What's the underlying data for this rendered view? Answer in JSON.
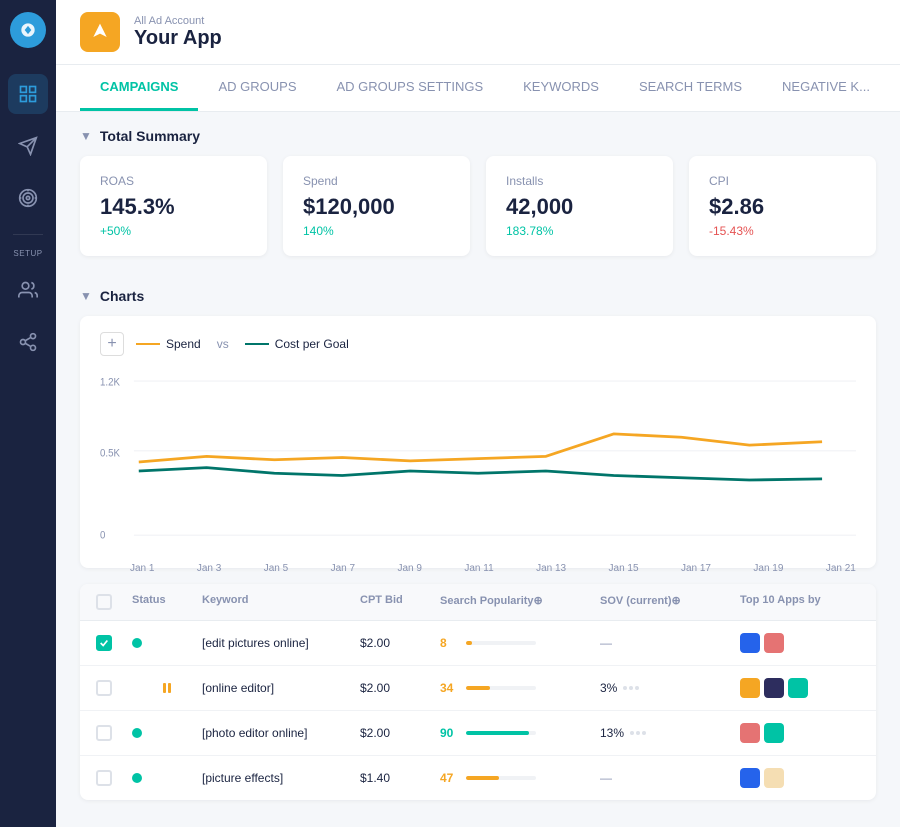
{
  "sidebar": {
    "logo_color": "#2d9cdb",
    "items": [
      {
        "id": "dashboard",
        "icon": "grid",
        "active": true
      },
      {
        "id": "campaigns",
        "icon": "send"
      },
      {
        "id": "targeting",
        "icon": "crosshair"
      },
      {
        "id": "setup",
        "label": "SETUP"
      },
      {
        "id": "users",
        "icon": "users"
      },
      {
        "id": "network",
        "icon": "share"
      }
    ]
  },
  "header": {
    "account": "All Ad Account",
    "app_name": "Your App"
  },
  "nav": {
    "tabs": [
      {
        "id": "campaigns",
        "label": "CAMPAIGNS",
        "active": true
      },
      {
        "id": "ad-groups",
        "label": "AD GROUPS"
      },
      {
        "id": "ad-groups-settings",
        "label": "AD GROUPS SETTINGS"
      },
      {
        "id": "keywords",
        "label": "KEYWORDS"
      },
      {
        "id": "search-terms",
        "label": "SEARCH TERMS"
      },
      {
        "id": "negative-k",
        "label": "NEGATIVE K..."
      }
    ]
  },
  "summary": {
    "title": "Total Summary",
    "cards": [
      {
        "label": "ROAS",
        "value": "145.3%",
        "change": "+50%",
        "change_type": "positive"
      },
      {
        "label": "Spend",
        "value": "$120,000",
        "change": "140%",
        "change_type": "positive"
      },
      {
        "label": "Installs",
        "value": "42,000",
        "change": "183.78%",
        "change_type": "positive"
      },
      {
        "label": "CPI",
        "value": "$2.86",
        "change": "-15.43%",
        "change_type": "negative"
      }
    ]
  },
  "charts": {
    "title": "Charts",
    "add_btn": "+",
    "legend": {
      "spend_label": "Spend",
      "vs_label": "vs",
      "cpg_label": "Cost per Goal"
    },
    "y_axis": [
      "1.2K",
      "0.5K",
      "0"
    ],
    "x_axis": [
      "Jan 1",
      "Jan 3",
      "Jan 5",
      "Jan 7",
      "Jan 9",
      "Jan 11",
      "Jan 13",
      "Jan 15",
      "Jan 17",
      "Jan 19",
      "Jan 21"
    ],
    "spend_color": "#f5a623",
    "cpg_color": "#00756a"
  },
  "table": {
    "columns": [
      "",
      "Status",
      "Keyword",
      "CPT Bid",
      "Search Popularity⊕",
      "SOV (current)⊕",
      "Top 10 Apps by"
    ],
    "rows": [
      {
        "checked": true,
        "status": "active",
        "keyword": "[edit pictures online]",
        "cpt_bid": "$2.00",
        "popularity_value": "8",
        "popularity_pct": 8,
        "popularity_color": "#f5a623",
        "sov": "—",
        "sov_pct": null,
        "top_apps": [
          "#2563eb",
          "#e57373"
        ]
      },
      {
        "checked": false,
        "status": "paused",
        "keyword": "[online editor]",
        "cpt_bid": "$2.00",
        "popularity_value": "34",
        "popularity_pct": 34,
        "popularity_color": "#f5a623",
        "sov": "3%",
        "sov_pct": 3,
        "top_apps": [
          "#f5a623",
          "#2d2d5e",
          "#00c3a5"
        ]
      },
      {
        "checked": false,
        "status": "active",
        "keyword": "[photo editor online]",
        "cpt_bid": "$2.00",
        "popularity_value": "90",
        "popularity_pct": 90,
        "popularity_color": "#00c3a5",
        "sov": "13%",
        "sov_pct": 13,
        "top_apps": [
          "#e57373",
          "#00c3a5"
        ]
      },
      {
        "checked": false,
        "status": "active",
        "keyword": "[picture effects]",
        "cpt_bid": "$1.40",
        "popularity_value": "47",
        "popularity_pct": 47,
        "popularity_color": "#f5a623",
        "sov": "—",
        "sov_pct": null,
        "top_apps": [
          "#2563eb",
          "#f5deb3"
        ]
      }
    ]
  }
}
